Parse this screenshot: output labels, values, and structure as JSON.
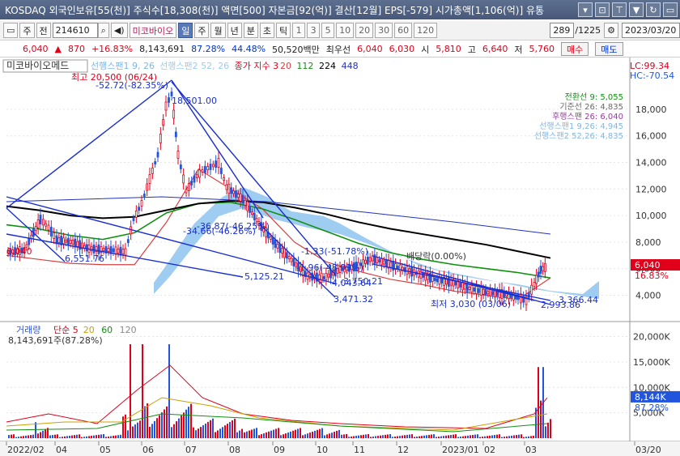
{
  "titlebar": {
    "text": "KOSDAQ 외국인보유[55(천)] 주식수[18,308(천)] 액면[500] 자본금[92(억)] 결산[12월] EPS[-579] 시가총액[1,106(억)] 유통",
    "buttons": [
      "▾",
      "⊡",
      "⊤",
      "▼",
      "↻",
      "▭"
    ]
  },
  "toolbar": {
    "left_box": "▭",
    "market": "주",
    "prev": "전",
    "code": "214610",
    "search_icon": "⌕",
    "sound_icon": "◀)",
    "name": "미코바이오",
    "periods": [
      "일",
      "주",
      "월",
      "년",
      "분",
      "초",
      "틱"
    ],
    "intervals": [
      "1",
      "3",
      "5",
      "10",
      "20",
      "30",
      "60",
      "120"
    ],
    "count": "289",
    "total": "/1225",
    "date": "2023/03/20"
  },
  "quote": {
    "price": "6,040",
    "change": "870",
    "change_pct": "+16.83%",
    "volume": "8,143,691",
    "vol_ratio": "87.28%",
    "turnover": "44.48%",
    "amount": "50,520백만",
    "priority_label": "최우선",
    "ask": "6,040",
    "bid": "6,030",
    "open_label": "시",
    "open": "5,810",
    "high_label": "고",
    "high": "6,640",
    "low_label": "저",
    "low": "5,760",
    "buy_btn": "매수",
    "sell_btn": "매도"
  },
  "chart_data": [
    {
      "type": "candlestick",
      "title": "미코바이오메드",
      "legend": [
        {
          "name": "선행스팬1 9, 26",
          "color": "#7eb6e6"
        },
        {
          "name": "선행스팬2 52, 26",
          "color": "#9ecbf0"
        },
        {
          "name": "종가 지수 3",
          "color": "#e0001b"
        },
        {
          "name": "20",
          "color": "#d84040"
        },
        {
          "name": "112",
          "color": "#109010"
        },
        {
          "name": "224",
          "color": "#000000"
        },
        {
          "name": "448",
          "color": "#2233bb"
        }
      ],
      "ichimoku_labels": [
        {
          "text": "전환선 9: 5,055",
          "color": "#109010"
        },
        {
          "text": "기준선 26: 4,835",
          "color": "#6a6a6a"
        },
        {
          "text": "후행스팬 26: 6,040",
          "color": "#9a3aa0"
        },
        {
          "text": "선행스팬1 9,26: 4,945",
          "color": "#7eb6e6"
        },
        {
          "text": "선행스팬2 52,26: 4,835",
          "color": "#7eb6e6"
        }
      ],
      "corner": {
        "lc": "LC:99.34",
        "hc": "HC:-70.54"
      },
      "y_ticks": [
        4000,
        6000,
        8000,
        10000,
        12000,
        14000,
        16000,
        18000
      ],
      "y_tick_labels": [
        "4,000",
        "6,000",
        "8,000",
        "10,000",
        "12,000",
        "14,000",
        "16,000",
        "18,000"
      ],
      "ylim": [
        2200,
        20800
      ],
      "x_labels": [
        "2022/02",
        "04",
        "05",
        "06",
        "07",
        "08",
        "09",
        "10",
        "11",
        "12",
        "2023/01",
        "02",
        "03",
        "03/20"
      ],
      "price_labels": [
        {
          "text": "6,040",
          "color": "#e0001b"
        },
        {
          "text": "16.83%",
          "color": "#e0001b"
        },
        {
          "text": "6,040",
          "color": "#e0001b",
          "note": "left axis"
        }
      ],
      "annotations": [
        "최고 20,500 (06/24)",
        "-52.72(-82.35%)",
        "18,501.00",
        "-36.87(-46.25%)",
        "-34.66(-46.26%)",
        "6,551.76",
        "5,125.21",
        "-1.33(-51.78%)",
        "-1.96(-48.99%)",
        "4,043.64",
        "-3,750.21",
        "3,471.32",
        "배당락(0.00%)",
        "최저 3,030 (03/06)",
        "3,366.44",
        "2,993.86"
      ],
      "ma_series": [
        {
          "name": "20",
          "values": [
            7000,
            6700,
            6400,
            6300,
            6300,
            9500,
            13500,
            12000,
            10500,
            8000,
            6500,
            5800,
            5200,
            4800,
            4300,
            4000,
            3700,
            5300
          ]
        },
        {
          "name": "112",
          "values": [
            9300,
            9000,
            8500,
            8200,
            8700,
            10200,
            10900,
            11000,
            10500,
            9700,
            8800,
            7900,
            7200,
            6700,
            6300,
            6000,
            5700,
            5300
          ]
        },
        {
          "name": "224",
          "values": [
            10700,
            10400,
            10000,
            9800,
            9900,
            10400,
            10900,
            11100,
            11000,
            10600,
            10100,
            9500,
            9000,
            8600,
            8200,
            7800,
            7300,
            6800
          ]
        }
      ]
    },
    {
      "type": "bar",
      "title": "거래량",
      "legend": [
        {
          "name": "거래량",
          "color": "#3355cc"
        },
        {
          "name": "단순 5",
          "color": "#e0001b"
        },
        {
          "name": "20",
          "color": "#c8a000"
        },
        {
          "name": "60",
          "color": "#109010"
        },
        {
          "name": "120",
          "color": "#8a8a8a"
        }
      ],
      "volume_label": "8,143,691주(87.28%)",
      "y_ticks": [
        5000000,
        10000000,
        15000000,
        20000000
      ],
      "y_tick_labels": [
        "5,000K",
        "10,000K",
        "15,000K",
        "20,000K"
      ],
      "ylim": [
        0,
        22000000
      ],
      "last_volume_label": "8,144K",
      "last_ratio_label": "87.28%"
    }
  ]
}
